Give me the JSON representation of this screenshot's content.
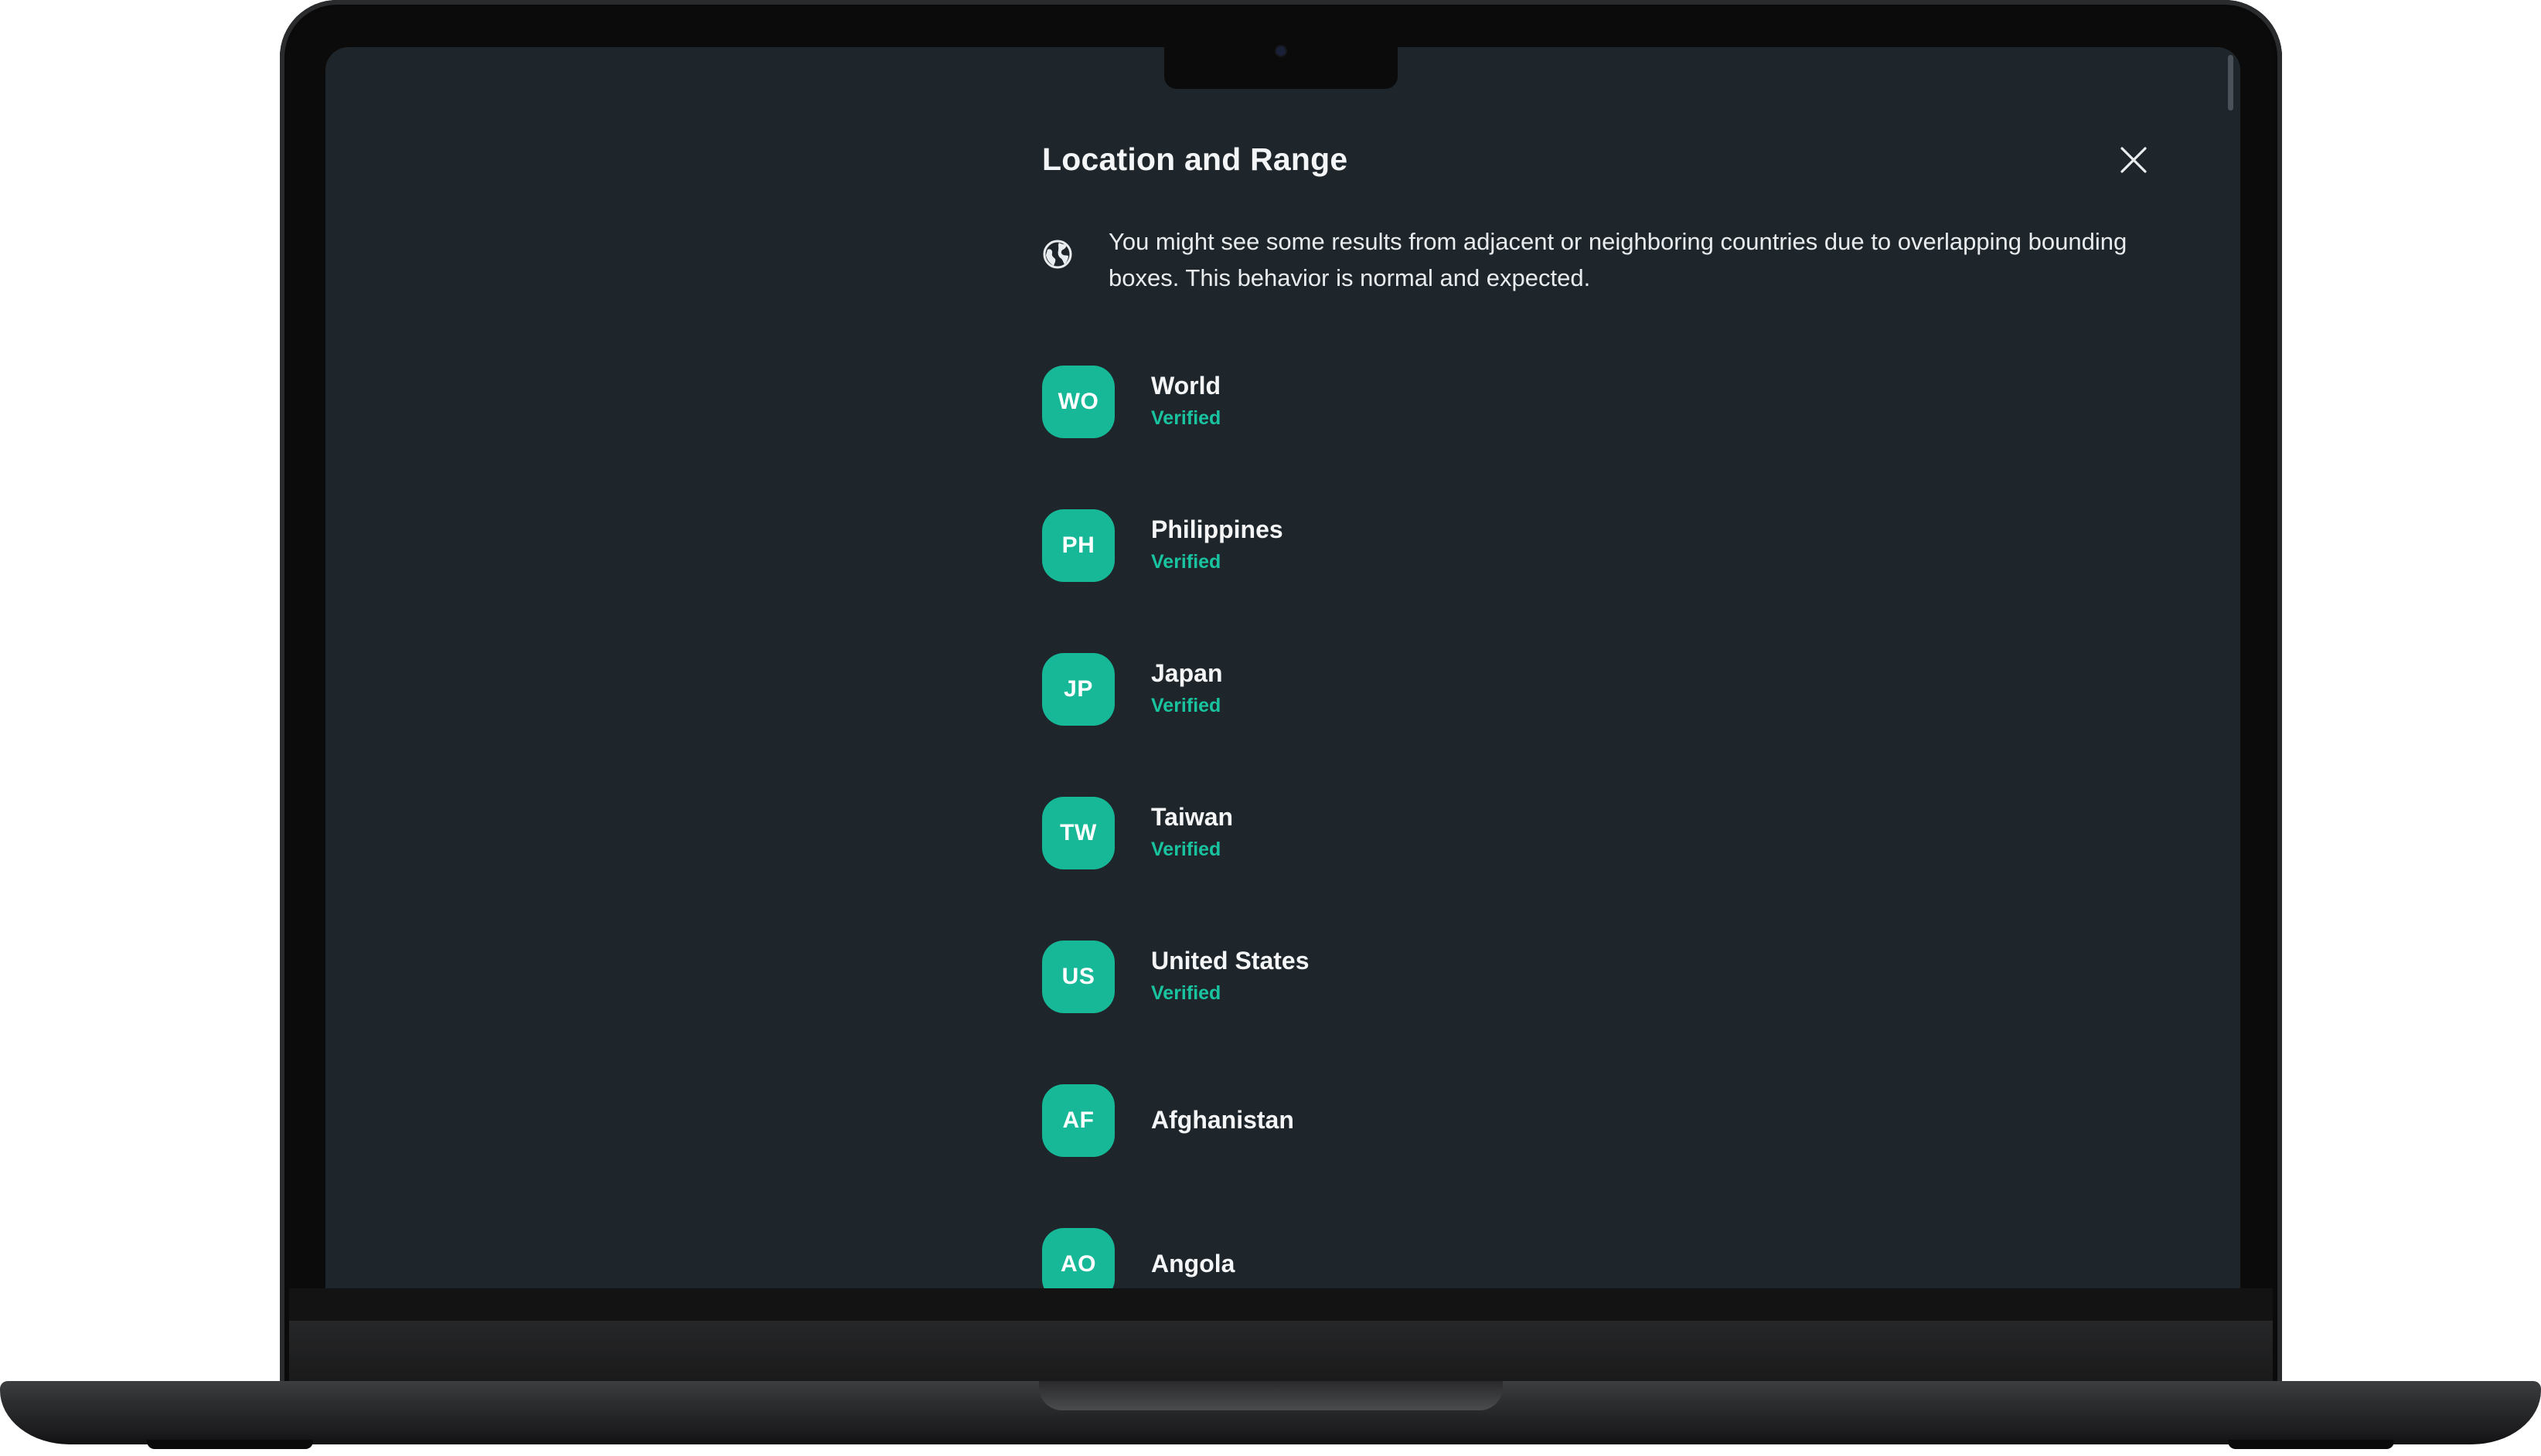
{
  "dialog": {
    "title": "Location and Range",
    "close_icon": "close-icon",
    "notice": {
      "icon": "globe-icon",
      "text": "You might see some results from adjacent or neighboring countries due to overlapping bounding boxes. This behavior is normal and expected."
    },
    "locations": [
      {
        "code": "WO",
        "name": "World",
        "status": "Verified"
      },
      {
        "code": "PH",
        "name": "Philippines",
        "status": "Verified"
      },
      {
        "code": "JP",
        "name": "Japan",
        "status": "Verified"
      },
      {
        "code": "TW",
        "name": "Taiwan",
        "status": "Verified"
      },
      {
        "code": "US",
        "name": "United States",
        "status": "Verified"
      },
      {
        "code": "AF",
        "name": "Afghanistan",
        "status": ""
      },
      {
        "code": "AO",
        "name": "Angola",
        "status": ""
      }
    ]
  },
  "colors": {
    "background": "#1f262b",
    "accent": "#17b897",
    "verified_text": "#19c39f",
    "primary_text": "#f3f5f6"
  }
}
